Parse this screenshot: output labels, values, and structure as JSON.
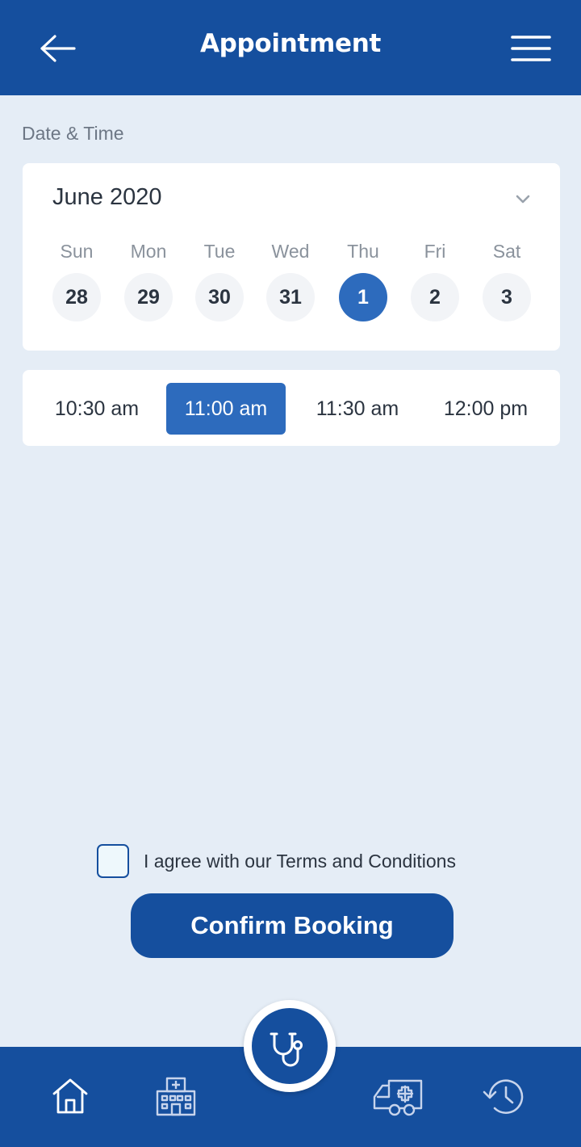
{
  "header": {
    "title": "Appointment"
  },
  "section_label": "Date & Time",
  "calendar": {
    "month": "June 2020",
    "days": [
      {
        "name": "Sun",
        "num": "28"
      },
      {
        "name": "Mon",
        "num": "29"
      },
      {
        "name": "Tue",
        "num": "30"
      },
      {
        "name": "Wed",
        "num": "31"
      },
      {
        "name": "Thu",
        "num": "1"
      },
      {
        "name": "Fri",
        "num": "2"
      },
      {
        "name": "Sat",
        "num": "3"
      }
    ],
    "selected_day": "1"
  },
  "times": {
    "slots": [
      "10:30 am",
      "11:00 am",
      "11:30 am",
      "12:00 pm"
    ],
    "selected": "11:00 am"
  },
  "terms": {
    "label": "I agree with our Terms and Conditions",
    "checked": false
  },
  "confirm_label": "Confirm Booking",
  "bottom_nav": {
    "items": [
      "home-icon",
      "hospital-icon",
      "stethoscope-icon",
      "ambulance-icon",
      "history-icon"
    ],
    "active": "stethoscope-icon"
  },
  "colors": {
    "primary": "#154f9e",
    "accent": "#2d6bbd",
    "background": "#e5edf6"
  }
}
